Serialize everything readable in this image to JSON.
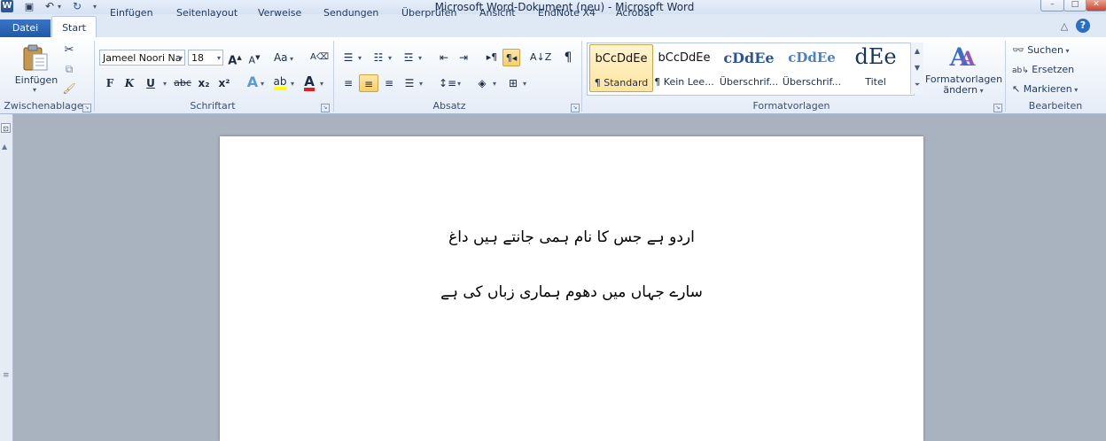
{
  "window": {
    "title": "Microsoft Word-Dokument (neu)  -  Microsoft Word",
    "minimize": "–",
    "maximize": "□"
  },
  "tabs": [
    "Datei",
    "Start",
    "Einfügen",
    "Seitenlayout",
    "Verweise",
    "Sendungen",
    "Überprüfen",
    "Ansicht",
    "EndNote X4",
    "Acrobat"
  ],
  "clipboard": {
    "paste_label": "Einfügen",
    "group_label": "Zwischenablage"
  },
  "font": {
    "name": "Jameel Noori Na",
    "size": "18",
    "case_label": "Aa",
    "bold": "F",
    "italic": "K",
    "underline": "U",
    "strike": "abc",
    "subscript": "x₂",
    "superscript": "x²",
    "group_label": "Schriftart"
  },
  "paragraph": {
    "group_label": "Absatz"
  },
  "styles": {
    "items": [
      {
        "preview": "bCcDdEe",
        "name": "¶ Standard"
      },
      {
        "preview": "bCcDdEe",
        "name": "¶ Kein Lee..."
      },
      {
        "preview": "cDdEe",
        "name": "Überschrif..."
      },
      {
        "preview": "cDdEe",
        "name": "Überschrif..."
      },
      {
        "preview": "dEe",
        "name": "Titel"
      }
    ],
    "change_label_1": "Formatvorlagen",
    "change_label_2": "ändern",
    "group_label": "Formatvorlagen"
  },
  "editing": {
    "find": "Suchen",
    "replace": "Ersetzen",
    "select": "Markieren",
    "group_label": "Bearbeiten"
  },
  "document": {
    "lines": [
      "اردو ہے جس کا نام ہمی جانتے ہیں داغ",
      "سارے جہاں میں دھوم ہماری زباں کی ہے"
    ]
  },
  "colors": {
    "accent": "#2b5797",
    "highlight": "#f8cf68"
  }
}
